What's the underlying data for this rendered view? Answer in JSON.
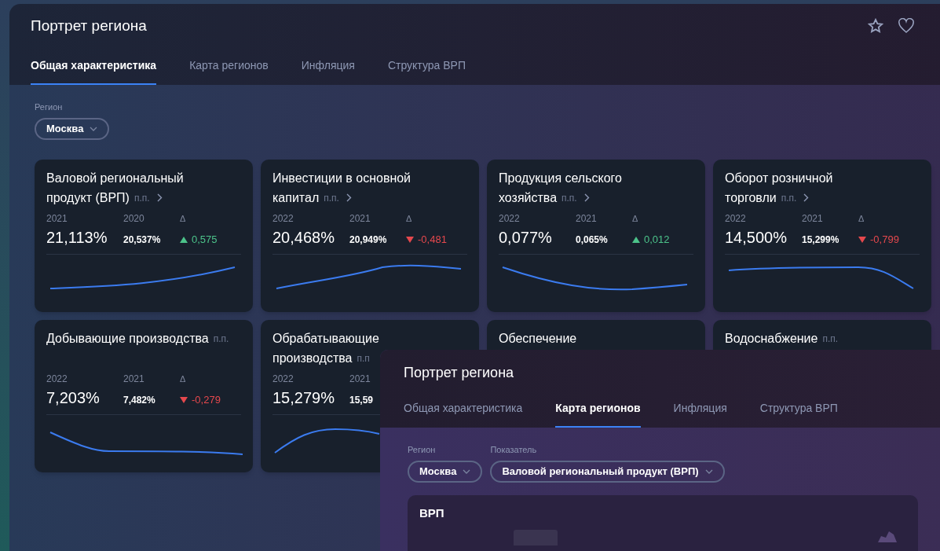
{
  "back_window": {
    "title": "Портрет региона",
    "tabs": [
      {
        "label": "Общая характеристика",
        "selected": true
      },
      {
        "label": "Карта регионов",
        "selected": false
      },
      {
        "label": "Инфляция",
        "selected": false
      },
      {
        "label": "Структура ВРП",
        "selected": false
      }
    ],
    "filters": [
      {
        "label": "Регион",
        "value": "Москва"
      }
    ],
    "cards": [
      {
        "title_lines": [
          "Валовой региональный",
          "продукт (ВРП)"
        ],
        "unit": "п.п.",
        "has_link": true,
        "stats": {
          "current_year": "2021",
          "current_value": "21,113%",
          "previous_year": "2020",
          "previous_value": "20,537%",
          "delta_label": "Δ",
          "delta": "0,575",
          "trend_up": true
        }
      },
      {
        "title_lines": [
          "Инвестиции в основной",
          "капитал"
        ],
        "unit": "п.п.",
        "has_link": true,
        "stats": {
          "current_year": "2022",
          "current_value": "20,468%",
          "previous_year": "2021",
          "previous_value": "20,949%",
          "delta_label": "Δ",
          "delta": "-0,481",
          "trend_up": false
        }
      },
      {
        "title_lines": [
          "Продукция сельского",
          "хозяйства"
        ],
        "unit": "п.п.",
        "has_link": true,
        "stats": {
          "current_year": "2022",
          "current_value": "0,077%",
          "previous_year": "2021",
          "previous_value": "0,065%",
          "delta_label": "Δ",
          "delta": "0,012",
          "trend_up": true
        }
      },
      {
        "title_lines": [
          "Оборот розничной",
          "торговли"
        ],
        "unit": "п.п.",
        "has_link": true,
        "stats": {
          "current_year": "2022",
          "current_value": "14,500%",
          "previous_year": "2021",
          "previous_value": "15,299%",
          "delta_label": "Δ",
          "delta": "-0,799",
          "trend_up": false
        }
      },
      {
        "title_lines": [
          "Добывающие производства"
        ],
        "unit": "п.п.",
        "has_link": false,
        "stats": {
          "current_year": "2022",
          "current_value": "7,203%",
          "previous_year": "2021",
          "previous_value": "7,482%",
          "delta_label": "Δ",
          "delta": "-0,279",
          "trend_up": false
        }
      },
      {
        "title_lines": [
          "Обрабатывающие",
          "производства"
        ],
        "unit": "п.п",
        "has_link": false,
        "stats": {
          "current_year": "2022",
          "current_value": "15,279%",
          "previous_year": "2021",
          "previous_value": "15,59"
        }
      },
      {
        "title_lines": [
          "Обеспечение"
        ],
        "has_link": false
      },
      {
        "title_lines": [
          "Водоснабжение"
        ],
        "unit": "п.п.",
        "has_link": false
      }
    ]
  },
  "front_window": {
    "title": "Портрет региона",
    "tabs": [
      {
        "label": "Общая характеристика",
        "selected": false
      },
      {
        "label": "Карта регионов",
        "selected": true
      },
      {
        "label": "Инфляция",
        "selected": false
      },
      {
        "label": "Структура ВРП",
        "selected": false
      }
    ],
    "filters": [
      {
        "label": "Регион",
        "value": "Москва"
      },
      {
        "label": "Показатель",
        "value": "Валовой региональный продукт (ВРП)"
      }
    ],
    "panel": {
      "title": "ВРП"
    }
  }
}
